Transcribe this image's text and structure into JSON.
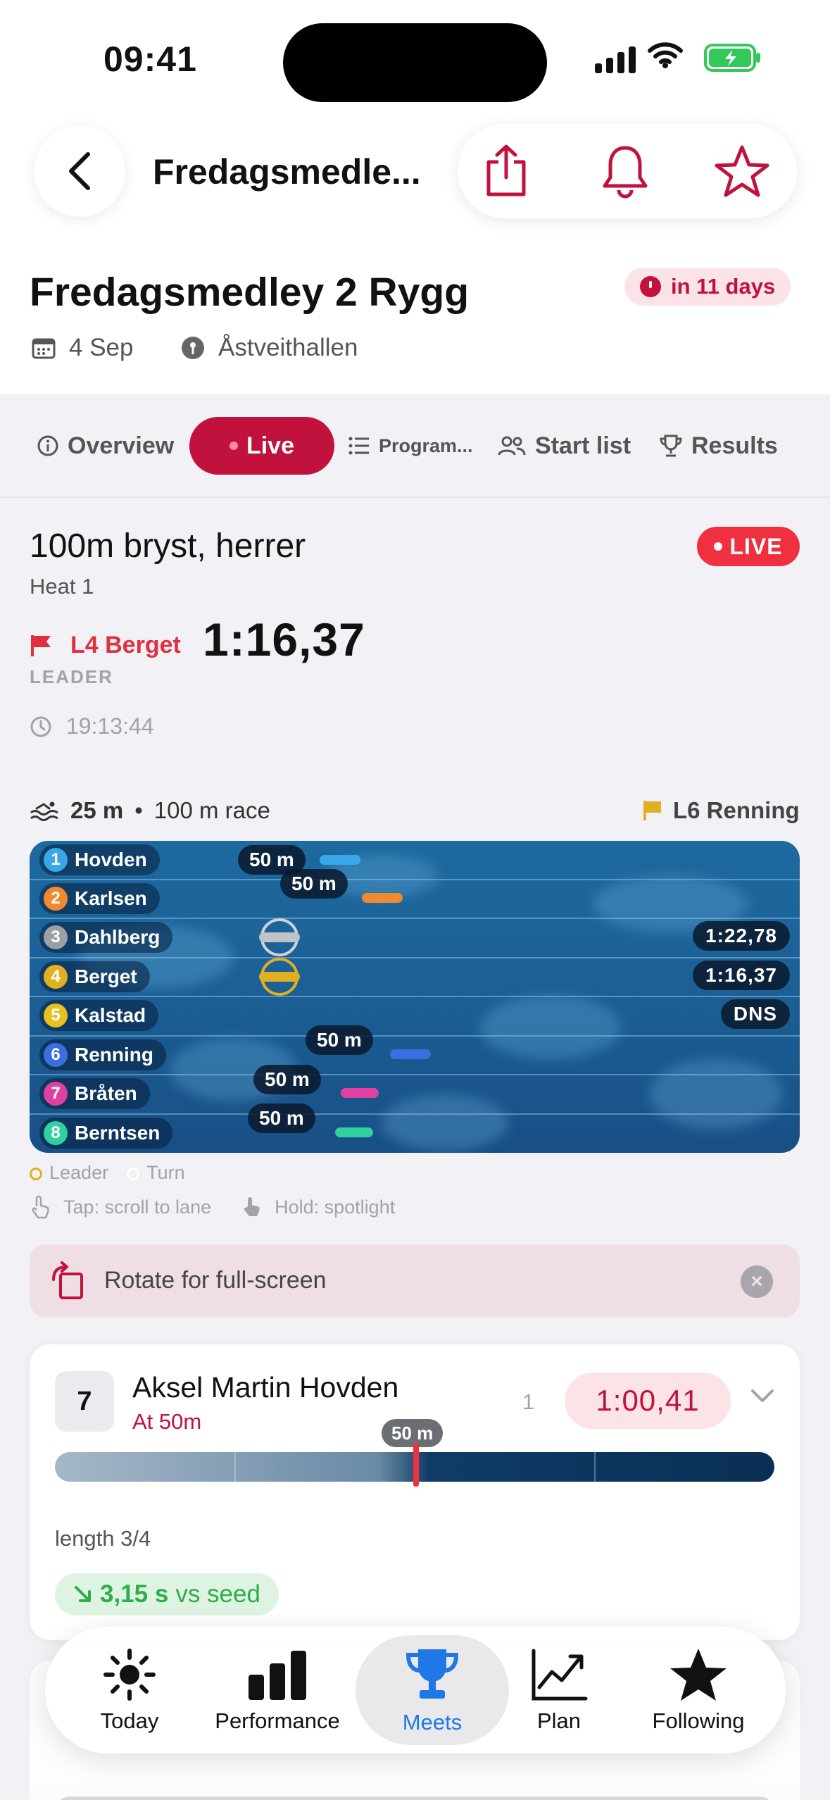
{
  "status_bar": {
    "time": "09:41"
  },
  "nav": {
    "title": "Fredagsmedle...",
    "actions": [
      "share-icon",
      "bell-icon",
      "star-icon"
    ]
  },
  "meet": {
    "title": "Fredagsmedley 2 Rygg",
    "countdown": "in 11 days",
    "date": "4 Sep",
    "venue": "Åstveithallen"
  },
  "tabs": [
    {
      "label": "Overview",
      "icon": "info-icon"
    },
    {
      "label": "Live",
      "active": true
    },
    {
      "label": "Program...",
      "icon": "list-icon"
    },
    {
      "label": "Start list",
      "icon": "people-icon"
    },
    {
      "label": "Results",
      "icon": "trophy-icon"
    }
  ],
  "event": {
    "title": "100m bryst, herrer",
    "heat": "Heat 1",
    "live_label": "LIVE",
    "leader_lane": "L4 Berget",
    "leader_time": "1:16,37",
    "leader_caption": "LEADER",
    "clock": "19:13:44"
  },
  "pool": {
    "length": "25 m",
    "race": "100 m race",
    "lead_indicator": "L6 Renning",
    "lanes": [
      {
        "lane": "1",
        "name": "Hovden",
        "color": "#3aa7e8",
        "split": "50 m",
        "progress": 0.5
      },
      {
        "lane": "2",
        "name": "Karlsen",
        "color": "#f08a30",
        "split": "50 m",
        "progress": 0.5
      },
      {
        "lane": "3",
        "name": "Dahlberg",
        "color": "#9aa0a6",
        "result": "1:22,78"
      },
      {
        "lane": "4",
        "name": "Berget",
        "color": "#e0b020",
        "result": "1:16,37"
      },
      {
        "lane": "5",
        "name": "Kalstad",
        "color": "#e8c020",
        "result": "DNS"
      },
      {
        "lane": "6",
        "name": "Renning",
        "color": "#3a6fe0",
        "split": "50 m",
        "progress": 0.5
      },
      {
        "lane": "7",
        "name": "Bråten",
        "color": "#e040a0",
        "split": "50 m",
        "progress": 0.5
      },
      {
        "lane": "8",
        "name": "Berntsen",
        "color": "#30d0a0",
        "split": "50 m",
        "progress": 0.5
      }
    ],
    "legend": {
      "leader": "Leader",
      "turn": "Turn"
    },
    "hints": {
      "tap": "Tap: scroll to lane",
      "hold": "Hold: spotlight"
    }
  },
  "rotate_banner": {
    "text": "Rotate for full-screen"
  },
  "athlete_card": {
    "lane": "7",
    "name": "Aksel Martin Hovden",
    "status": "At 50m",
    "place": "1",
    "time": "1:00,41",
    "marker_label": "50 m",
    "length": "length 3/4",
    "vs_seed_value": "3,15 s",
    "vs_seed_label": "vs seed"
  },
  "tab_bar": [
    {
      "label": "Today",
      "icon": "sun-icon"
    },
    {
      "label": "Performance",
      "icon": "bar-chart-icon"
    },
    {
      "label": "Meets",
      "icon": "trophy-icon",
      "active": true
    },
    {
      "label": "Plan",
      "icon": "trend-icon"
    },
    {
      "label": "Following",
      "icon": "star-icon"
    }
  ],
  "colors": {
    "accent": "#c0123c",
    "live": "#f0303f",
    "active_tab": "#1f78e6",
    "pool": "#1b5f95"
  }
}
